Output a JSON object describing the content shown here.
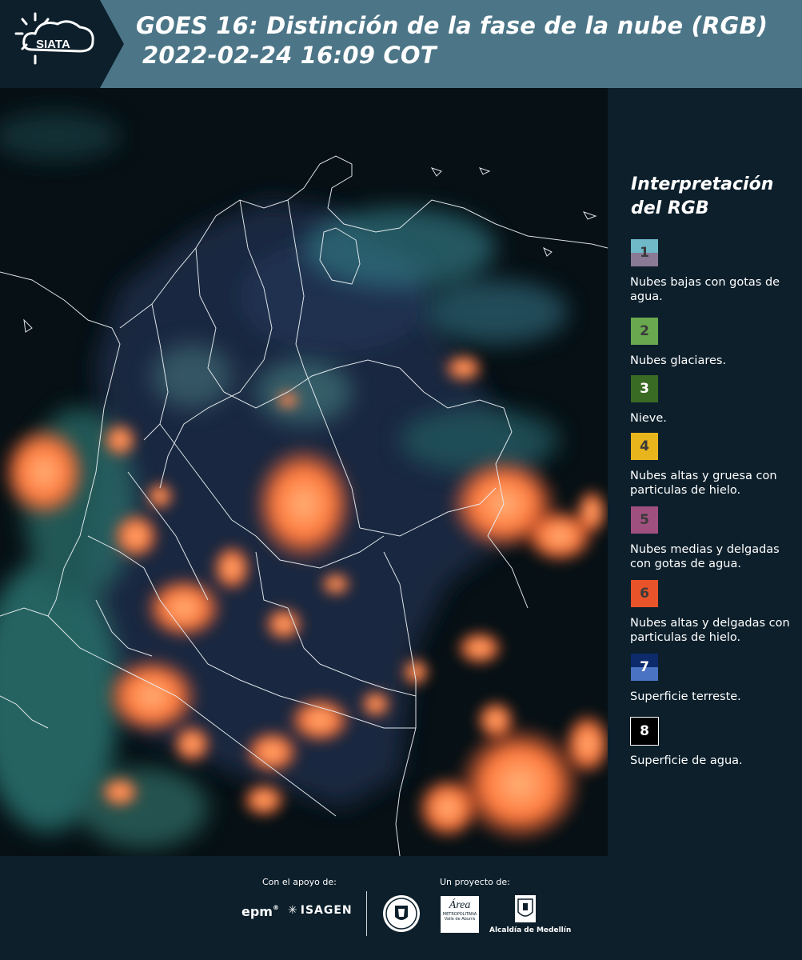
{
  "header": {
    "title_line1": "GOES 16: Distinción de la fase de la nube (RGB)",
    "title_line2": "2022-02-24 16:09 COT",
    "logo_text": "SIATA",
    "background_color": "#4c7687"
  },
  "legend": {
    "title": "Interpretación del RGB",
    "items": [
      {
        "number": "1",
        "label": "Nubes bajas con gotas de agua.",
        "color_top": "#6fb9c8",
        "color_bottom": "#8a7a95"
      },
      {
        "number": "2",
        "label": "Nubes glaciares.",
        "color_top": "#6aa84f",
        "color_bottom": "#6aa84f"
      },
      {
        "number": "3",
        "label": "Nieve.",
        "color_top": "#3a6b24",
        "color_bottom": "#3a6b24"
      },
      {
        "number": "4",
        "label": "Nubes altas y gruesa con particulas de hielo.",
        "color_top": "#e8b51d",
        "color_bottom": "#e8b51d"
      },
      {
        "number": "5",
        "label": "Nubes medias y delgadas con gotas de agua.",
        "color_top": "#a0507f",
        "color_bottom": "#a0507f"
      },
      {
        "number": "6",
        "label": "Nubes altas y delgadas con particulas de hielo.",
        "color_top": "#e8532a",
        "color_bottom": "#e8532a"
      },
      {
        "number": "7",
        "label": "Superficie terreste.",
        "color_top": "#0d2a6b",
        "color_bottom": "#4a73c4"
      },
      {
        "number": "8",
        "label": "Superficie de agua.",
        "color_top": "#000000",
        "color_bottom": "#000000"
      }
    ]
  },
  "footer": {
    "support_caption": "Con el apoyo de:",
    "project_caption": "Un proyecto de:",
    "sponsor_epm": "epm",
    "sponsor_isagen": "ISAGEN",
    "partner_area": "Área",
    "partner_area_sub": "METROPOLITANA",
    "partner_area_sub2": "Valle de Aburrá",
    "partner_alcaldia": "Alcaldía de Medellín"
  }
}
